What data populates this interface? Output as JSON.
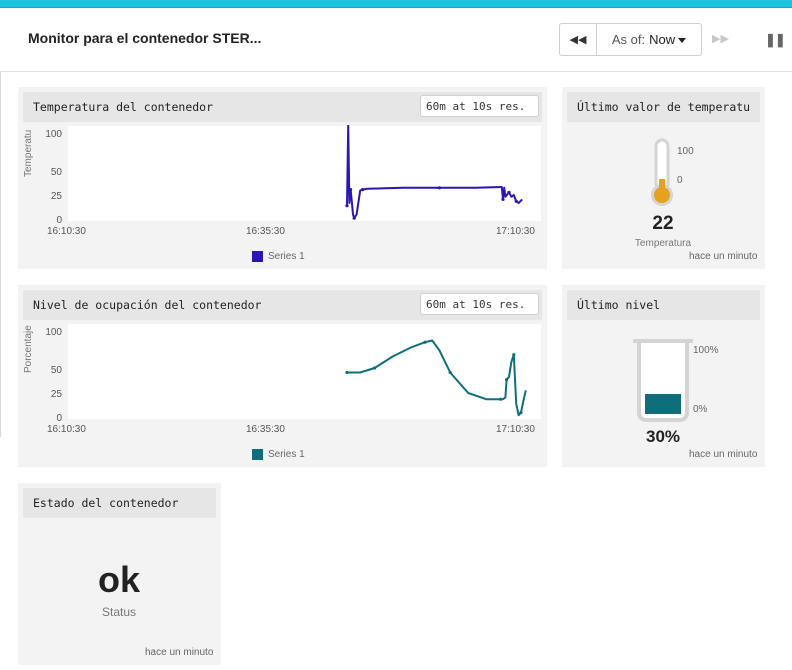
{
  "header": {
    "title": "Monitor para el contenedor STER...",
    "as_of_label": "As of:",
    "as_of_value": "Now"
  },
  "panels": {
    "temperature_chart": {
      "title": "Temperatura del contenedor",
      "resolution": "60m at 10s res.",
      "ylabel": "Temperatu",
      "legend": "Series 1"
    },
    "temperature_value": {
      "title": "Último valor de temperatu",
      "gauge_max": "100",
      "gauge_min": "0",
      "value": "22",
      "label": "Temperatura",
      "updated": "hace un minuto"
    },
    "level_chart": {
      "title": "Nivel de ocupación del contenedor",
      "resolution": "60m at 10s res.",
      "ylabel": "Porcentaje",
      "legend": "Series 1"
    },
    "level_value": {
      "title": "Último nivel",
      "gauge_max": "100%",
      "gauge_min": "0%",
      "value": "30%",
      "updated": "hace un minuto"
    },
    "status": {
      "title": "Estado del contenedor",
      "value": "ok",
      "label": "Status",
      "updated": "hace un minuto"
    }
  },
  "colors": {
    "accent": "#1ec3de",
    "temperature_series": "#2a16b2",
    "level_series": "#0e6f7a",
    "thermo_fill": "#e6a21c"
  },
  "gauges": {
    "temperature_fraction": 0.22,
    "level_fraction": 0.3
  },
  "chart_data": [
    {
      "type": "line",
      "title": "Temperatura del contenedor",
      "ylabel": "Temperatu",
      "x_ticks": [
        "16:10:30",
        "16:35:30",
        "17:10:30"
      ],
      "y_ticks": [
        0,
        25,
        50,
        100
      ],
      "ylim": [
        0,
        100
      ],
      "xlim": [
        "16:10:30",
        "17:12:00"
      ],
      "grid": false,
      "legend_position": "bottom-center",
      "series": [
        {
          "name": "Series 1",
          "color": "#2a16b2",
          "x": [
            "16:47:10",
            "16:47:20",
            "16:47:30",
            "16:47:40",
            "16:47:50",
            "16:48:00",
            "16:48:10",
            "16:48:30",
            "16:49:00",
            "16:49:20",
            "16:50:00",
            "16:55:00",
            "17:00:00",
            "17:05:00",
            "17:08:40",
            "17:08:50",
            "17:09:00",
            "17:09:10",
            "17:09:40",
            "17:10:00",
            "17:10:20",
            "17:10:40",
            "17:11:00",
            "17:11:30"
          ],
          "values": [
            15,
            105,
            18,
            33,
            20,
            5,
            1,
            5,
            32,
            33,
            34,
            35,
            35,
            35,
            36,
            22,
            35,
            25,
            30,
            25,
            27,
            20,
            18,
            22
          ]
        }
      ]
    },
    {
      "type": "line",
      "title": "Nivel de ocupación del contenedor",
      "ylabel": "Porcentaje",
      "x_ticks": [
        "16:10:30",
        "16:35:30",
        "17:10:30"
      ],
      "y_ticks": [
        0,
        25,
        50,
        100
      ],
      "ylim": [
        0,
        100
      ],
      "xlim": [
        "16:10:30",
        "17:12:00"
      ],
      "grid": false,
      "legend_position": "bottom-center",
      "series": [
        {
          "name": "Series 1",
          "color": "#0e6f7a",
          "x": [
            "16:47:10",
            "16:48:00",
            "16:49:00",
            "16:51:00",
            "16:53:30",
            "16:56:00",
            "16:58:00",
            "16:59:00",
            "17:00:00",
            "17:01:30",
            "17:04:00",
            "17:06:30",
            "17:08:30",
            "17:08:50",
            "17:09:10",
            "17:09:20",
            "17:09:40",
            "17:10:00",
            "17:10:20",
            "17:10:40",
            "17:11:00",
            "17:11:20",
            "17:11:40",
            "17:12:00"
          ],
          "values": [
            50,
            50,
            50,
            55,
            68,
            78,
            84,
            86,
            75,
            50,
            27,
            20,
            20,
            20,
            22,
            42,
            45,
            62,
            70,
            15,
            2,
            5,
            18,
            30
          ]
        }
      ]
    }
  ]
}
